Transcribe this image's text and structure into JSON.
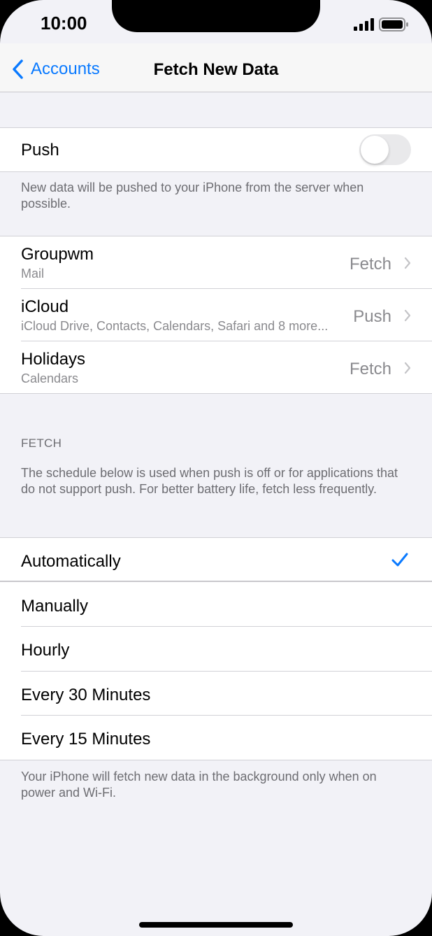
{
  "status_bar": {
    "time": "10:00"
  },
  "nav": {
    "back_label": "Accounts",
    "title": "Fetch New Data"
  },
  "push_section": {
    "label": "Push",
    "toggle_on": false,
    "footer": "New data will be pushed to your iPhone from the server when possible."
  },
  "accounts": [
    {
      "name": "Groupwm",
      "detail": "Mail",
      "value": "Fetch"
    },
    {
      "name": "iCloud",
      "detail": "iCloud Drive, Contacts, Calendars, Safari and 8 more...",
      "value": "Push"
    },
    {
      "name": "Holidays",
      "detail": "Calendars",
      "value": "Fetch"
    }
  ],
  "fetch_section": {
    "header": "FETCH",
    "description": "The schedule below is used when push is off or for applications that do not support push. For better battery life, fetch less frequently.",
    "options": [
      {
        "label": "Automatically",
        "selected": true
      },
      {
        "label": "Manually",
        "selected": false
      },
      {
        "label": "Hourly",
        "selected": false
      },
      {
        "label": "Every 30 Minutes",
        "selected": false
      },
      {
        "label": "Every 15 Minutes",
        "selected": false
      }
    ],
    "footer": "Your iPhone will fetch new data in the background only when on power and Wi-Fi."
  },
  "colors": {
    "accent": "#0a7aff",
    "background": "#f2f2f7",
    "secondary_text": "#8a8a8e"
  }
}
